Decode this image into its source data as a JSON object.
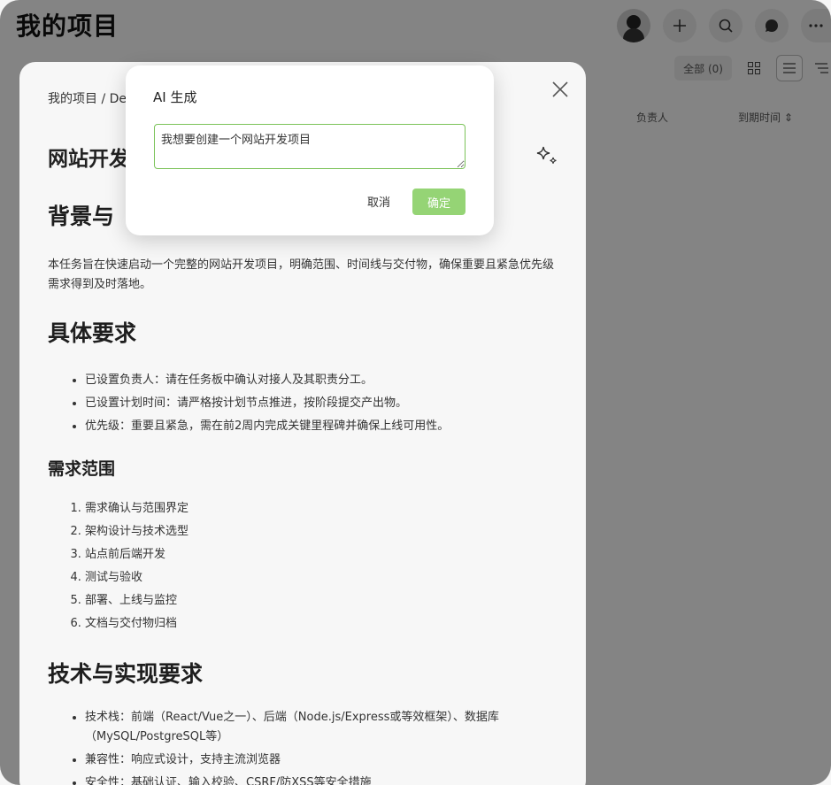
{
  "app": {
    "title": "我的项目",
    "filter_label": "全部 (0)",
    "columns": {
      "assignee": "负责人",
      "due": "到期时间 ⇕"
    }
  },
  "panel": {
    "breadcrumb": "我的项目 / De",
    "title": "网站开发",
    "sections": {
      "background_heading": "背景与",
      "background_text": "本任务旨在快速启动一个完整的网站开发项目，明确范围、时间线与交付物，确保重要且紧急优先级需求得到及时落地。",
      "requirements_heading": "具体要求",
      "requirements": [
        "已设置负责人：请在任务板中确认对接人及其职责分工。",
        "已设置计划时间：请严格按计划节点推进，按阶段提交产出物。",
        "优先级：重要且紧急，需在前2周内完成关键里程碑并确保上线可用性。"
      ],
      "scope_heading": "需求范围",
      "scope": [
        "需求确认与范围界定",
        "架构设计与技术选型",
        "站点前后端开发",
        "测试与验收",
        "部署、上线与监控",
        "文档与交付物归档"
      ],
      "tech_heading": "技术与实现要求",
      "tech": [
        "技术栈：前端（React/Vue之一）、后端（Node.js/Express或等效框架）、数据库（MySQL/PostgreSQL等）",
        "兼容性：响应式设计，支持主流浏览器",
        "安全性：基础认证、输入校验、CSRF/防XSS等安全措施"
      ]
    }
  },
  "dialog": {
    "title": "AI 生成",
    "input_value": "我想要创建一个网站开发项目",
    "cancel_label": "取消",
    "ok_label": "确定"
  },
  "colors": {
    "primary_green": "#95d475",
    "input_border": "#7cc35a",
    "overlay": "rgba(0,0,0,0.47)"
  }
}
